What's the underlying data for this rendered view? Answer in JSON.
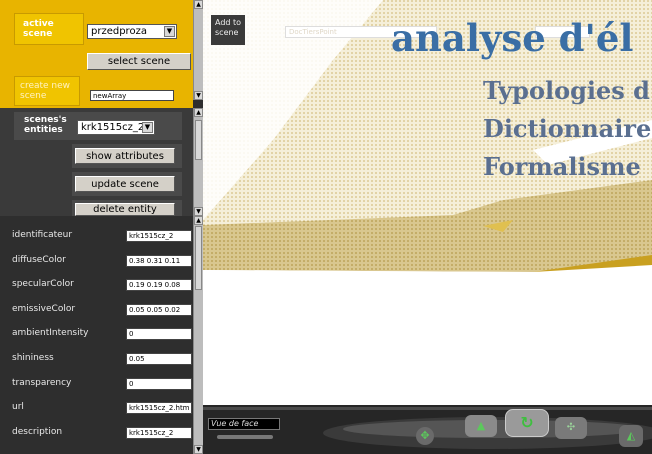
{
  "left_panel": {
    "active_scene_label": "active scene",
    "active_scene_value": "przedproza",
    "select_scene_label": "select scene",
    "create_new_scene_label": "create new scene",
    "create_new_scene_value": "newArray",
    "entities_label": "scenes's entities",
    "entity_value": "krk1515cz_2",
    "show_attributes_label": "show attributes",
    "update_scene_label": "update scene",
    "delete_entity_label": "delete entity"
  },
  "attributes": [
    {
      "name": "identificateur",
      "value": "krk1515cz_2"
    },
    {
      "name": "diffuseColor",
      "value": "0.38 0.31 0.11"
    },
    {
      "name": "specularColor",
      "value": "0.19 0.19 0.08"
    },
    {
      "name": "emissiveColor",
      "value": "0.05 0.05 0.02"
    },
    {
      "name": "ambientIntensity",
      "value": "0"
    },
    {
      "name": "shininess",
      "value": "0.05"
    },
    {
      "name": "transparency",
      "value": "0"
    },
    {
      "name": "url",
      "value": "krk1515cz_2.htm"
    },
    {
      "name": "description",
      "value": "krk1515cz_2"
    }
  ],
  "viewer": {
    "add_to_scene_label": "Add to scene",
    "doc_field_value": "DocTiersPoint",
    "heading": "analyse d'él",
    "lines": [
      "Typologies d",
      "Dictionnaire",
      "Formalisme"
    ]
  },
  "navigation": {
    "viewpoint_value": "Vue de face"
  },
  "colors": {
    "panel_yellow": "#e8b400",
    "panel_dark": "#2e2e2e",
    "title_blue": "#3a6ea5",
    "sub_blue": "#5a6f90"
  }
}
